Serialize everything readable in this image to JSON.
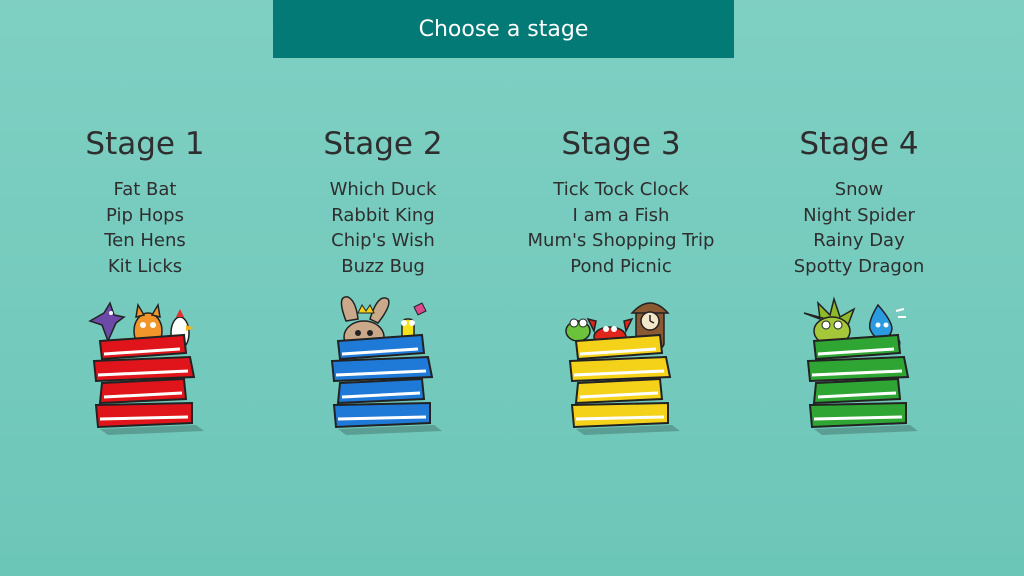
{
  "header": {
    "title": "Choose a stage"
  },
  "stages": [
    {
      "title": "Stage 1",
      "stories": [
        "Fat Bat",
        "Pip Hops",
        "Ten Hens",
        "Kit Licks"
      ],
      "book_color": "#e0151b",
      "book_shade": "#a80d12",
      "characters_icon": "bat-cat-hen-characters"
    },
    {
      "title": "Stage 2",
      "stories": [
        "Which Duck",
        "Rabbit King",
        "Chip's Wish",
        "Buzz Bug"
      ],
      "book_color": "#1f79d6",
      "book_shade": "#11509a",
      "characters_icon": "rabbit-bug-characters"
    },
    {
      "title": "Stage 3",
      "stories": [
        "Tick Tock Clock",
        "I am a Fish",
        "Mum's Shopping Trip",
        "Pond Picnic"
      ],
      "book_color": "#f4d21a",
      "book_shade": "#b89a08",
      "characters_icon": "frog-crab-clock-characters"
    },
    {
      "title": "Stage 4",
      "stories": [
        "Snow",
        "Night Spider",
        "Rainy Day",
        "Spotty Dragon"
      ],
      "book_color": "#2fa534",
      "book_shade": "#1c7420",
      "characters_icon": "dragon-raindrop-characters"
    }
  ]
}
